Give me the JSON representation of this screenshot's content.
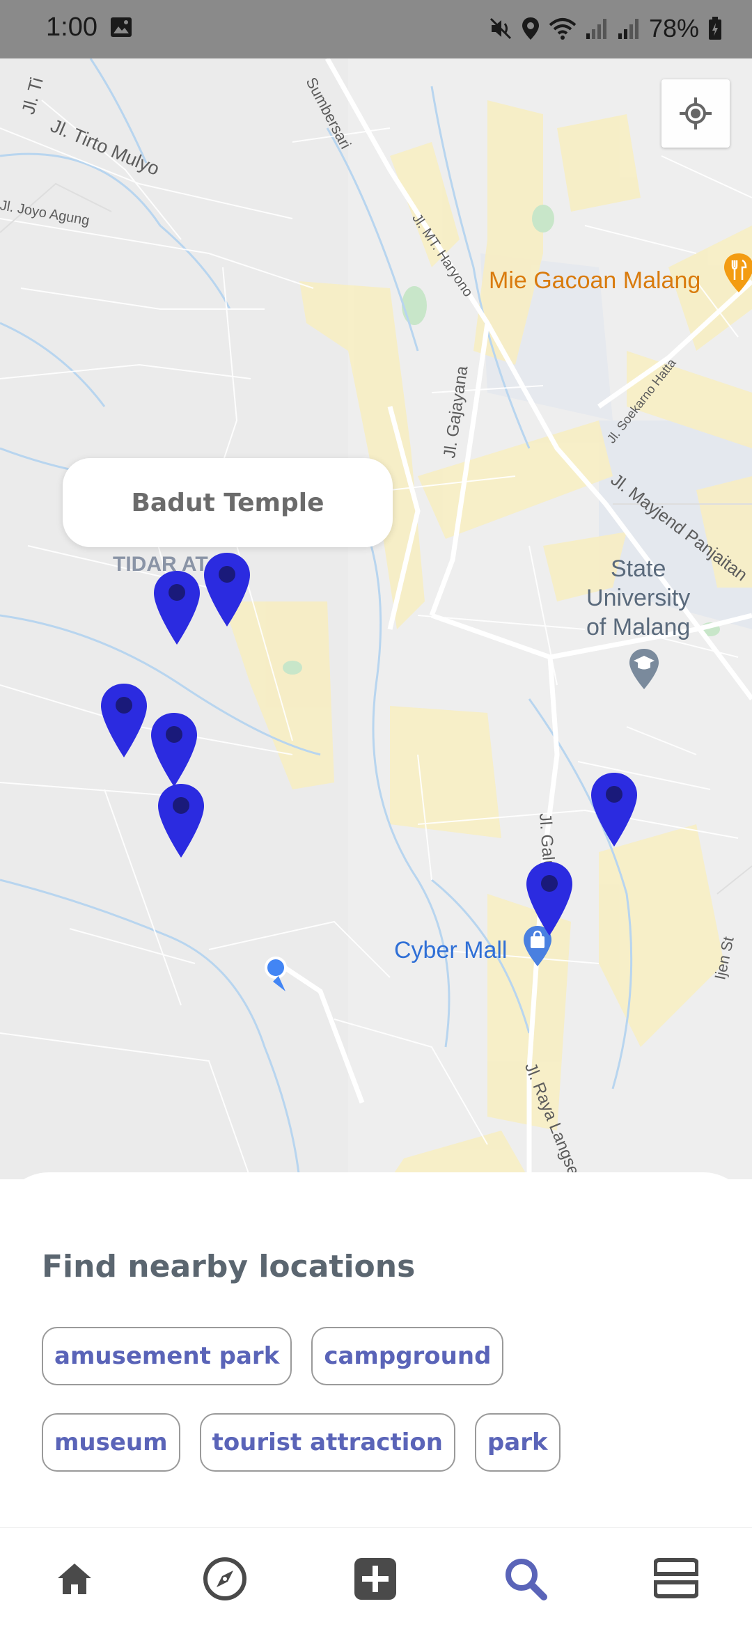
{
  "status_bar": {
    "time": "1:00",
    "battery": "78%"
  },
  "map": {
    "road_labels": [
      "Jl. Tirto Mulyo",
      "Jl. Joyo Agung",
      "Jl. MT. Haryono",
      "Jl. Gajayana",
      "Jl. Soekarno Hatta",
      "Jl. Mayjend Panjaitan",
      "Jl. Galunggung",
      "Jl. Raya Langsep",
      "Ijen St",
      "Jl. Ti",
      "Sumbersari"
    ],
    "area_label": "TIDAR AT",
    "poi": {
      "restaurant": "Mie Gacoan Malang",
      "university_line1": "State",
      "university_line2": "University",
      "university_line3": "of Malang",
      "mall": "Cyber Mall"
    },
    "callout": "Badut Temple",
    "pin_color": "#2b2be0",
    "user_dot_color": "#4285f4"
  },
  "sheet": {
    "title": "Find nearby locations",
    "chips_row1": [
      "amusement park",
      "campground"
    ],
    "chips_row2": [
      "museum",
      "tourist attraction",
      "park"
    ]
  },
  "nav": {
    "items": [
      "home-icon",
      "compass-icon",
      "add-icon",
      "search-icon",
      "bookmarks-icon"
    ],
    "active": "search-icon",
    "active_color": "#5a64b8",
    "inactive_color": "#4a4a4a"
  }
}
